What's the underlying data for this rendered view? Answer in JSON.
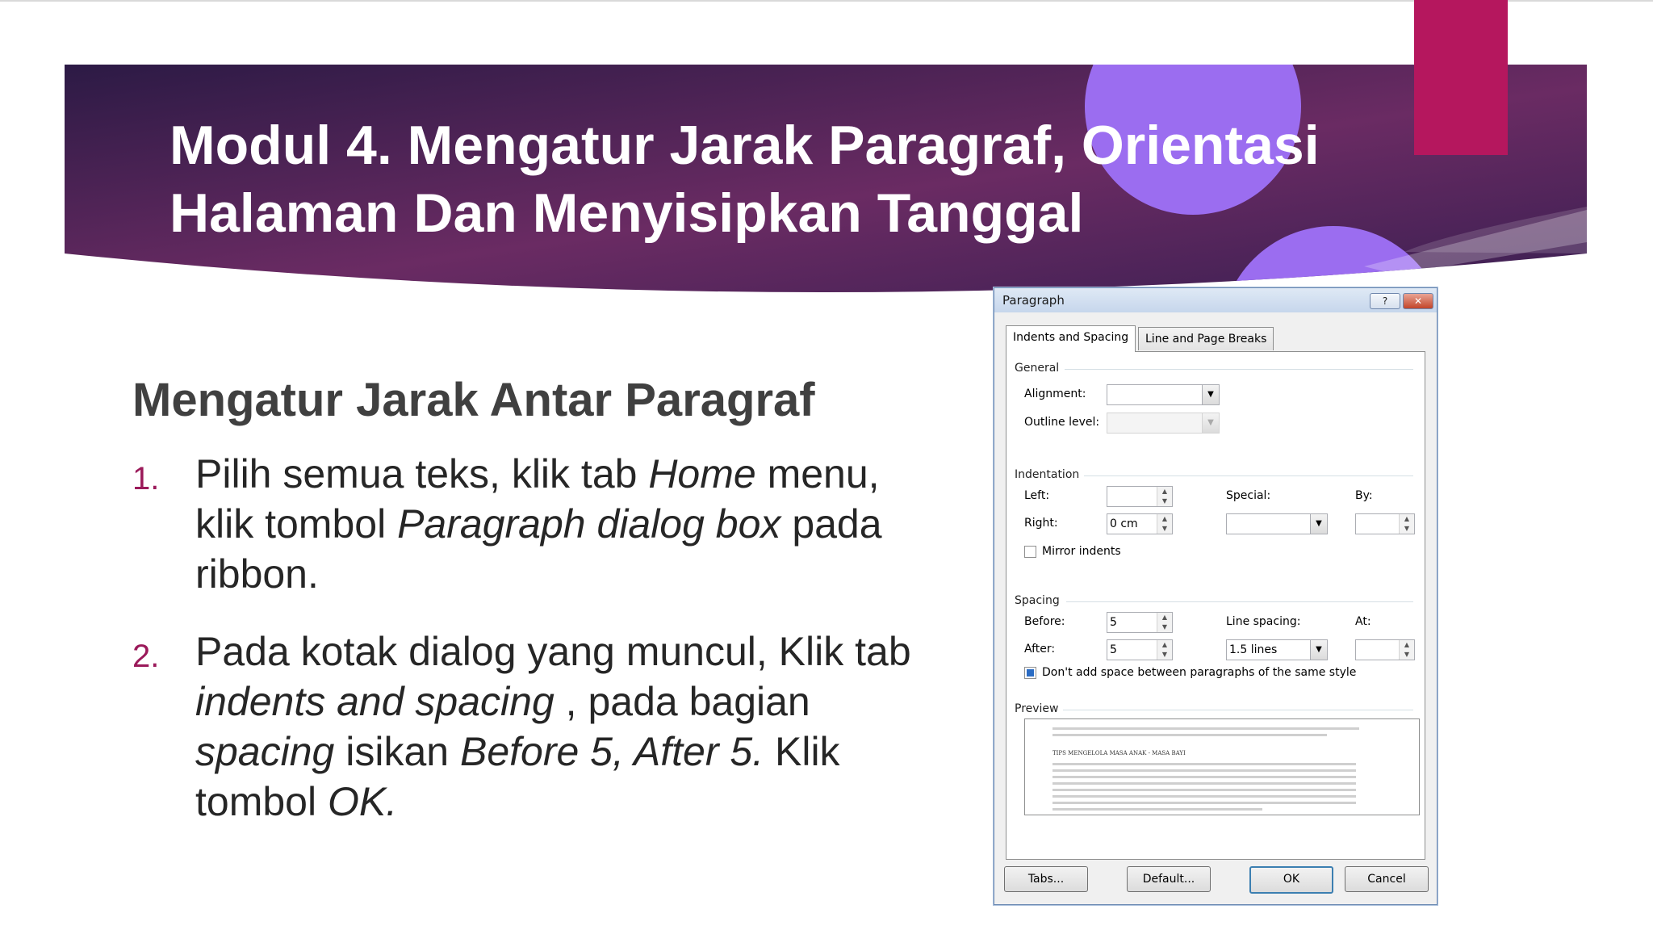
{
  "slide": {
    "title_line1": "Modul 4. Mengatur Jarak Paragraf, Orientasi",
    "title_line2": "Halaman Dan Menyisipkan Tanggal",
    "subheading": "Mengatur Jarak Antar Paragraf",
    "steps": [
      {
        "num": "1.",
        "parts": [
          "Pilih semua teks, klik tab ",
          "Home",
          " menu, klik tombol ",
          "Paragraph dialog box",
          " pada ribbon."
        ]
      },
      {
        "num": "2.",
        "parts": [
          "Pada kotak dialog yang muncul, Klik tab ",
          "indents and spacing",
          " , pada bagian ",
          "spacing",
          " isikan ",
          "Before 5, After 5.",
          " Klik tombol ",
          "OK."
        ]
      }
    ]
  },
  "colors": {
    "banner_dark": "#2c1a45",
    "banner_mid": "#6a2b63",
    "accent": "#b5175e",
    "circle": "#9b6df0",
    "list_number": "#9b1a5a"
  },
  "dialog": {
    "title": "Paragraph",
    "help_button": "?",
    "close_button": "✕",
    "tabs": [
      "Indents and Spacing",
      "Line and Page Breaks"
    ],
    "general": {
      "label": "General",
      "alignment_label": "Alignment:",
      "alignment_value": "",
      "outline_label": "Outline level:",
      "outline_value": ""
    },
    "indentation": {
      "label": "Indentation",
      "left_label": "Left:",
      "left_value": "",
      "right_label": "Right:",
      "right_value": "0 cm",
      "special_label": "Special:",
      "special_value": "",
      "by_label": "By:",
      "by_value": "",
      "mirror_label": "Mirror indents",
      "mirror_checked": false
    },
    "spacing": {
      "label": "Spacing",
      "before_label": "Before:",
      "before_value": "5",
      "after_label": "After:",
      "after_value": "5",
      "line_spacing_label": "Line spacing:",
      "line_spacing_value": "1.5 lines",
      "at_label": "At:",
      "at_value": "",
      "dont_add_label": "Don't add space between paragraphs of the same style",
      "dont_add_checked": true
    },
    "preview": {
      "label": "Preview",
      "sample_heading": "TIPS MENGELOLA MASA ANAK - MASA BAYI"
    },
    "buttons": {
      "tabs": "Tabs...",
      "default": "Default...",
      "ok": "OK",
      "cancel": "Cancel"
    }
  }
}
